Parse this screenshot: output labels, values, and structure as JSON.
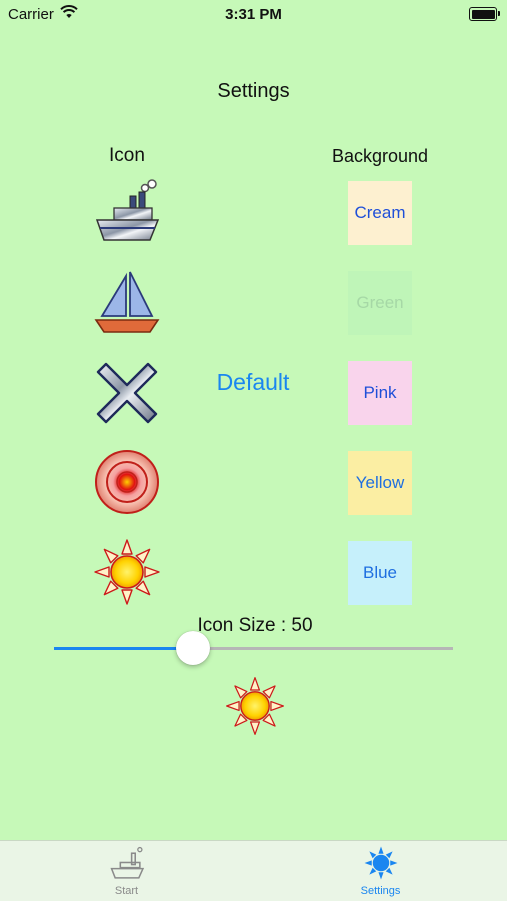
{
  "status_bar": {
    "carrier": "Carrier",
    "time": "3:31 PM"
  },
  "page": {
    "title": "Settings"
  },
  "columns": {
    "icon_header": "Icon",
    "background_header": "Background"
  },
  "icons": [
    "ship-icon",
    "sailboat-icon",
    "x-icon",
    "target-icon",
    "sun-icon"
  ],
  "default_button": "Default",
  "backgrounds": [
    {
      "label": "Cream",
      "color": "#fdf0d0",
      "text_color": "#1f4fd8"
    },
    {
      "label": "Green",
      "color": "#bff5b8",
      "text_color": "#a6d8a6"
    },
    {
      "label": "Pink",
      "color": "#f9d4ec",
      "text_color": "#1f4fd8"
    },
    {
      "label": "Yellow",
      "color": "#fbeea3",
      "text_color": "#1f6fe0"
    },
    {
      "label": "Blue",
      "color": "#c6f0fb",
      "text_color": "#1f6fe0"
    }
  ],
  "icon_size": {
    "label": "Icon Size : 50",
    "value": 50,
    "slider_fraction": 0.34
  },
  "preview_icon": "sun-icon",
  "tabs": [
    {
      "label": "Start",
      "icon": "ship-icon",
      "selected": false,
      "color": "#8a8a8a"
    },
    {
      "label": "Settings",
      "icon": "sun-icon",
      "selected": true,
      "color": "#1a86f0"
    }
  ]
}
